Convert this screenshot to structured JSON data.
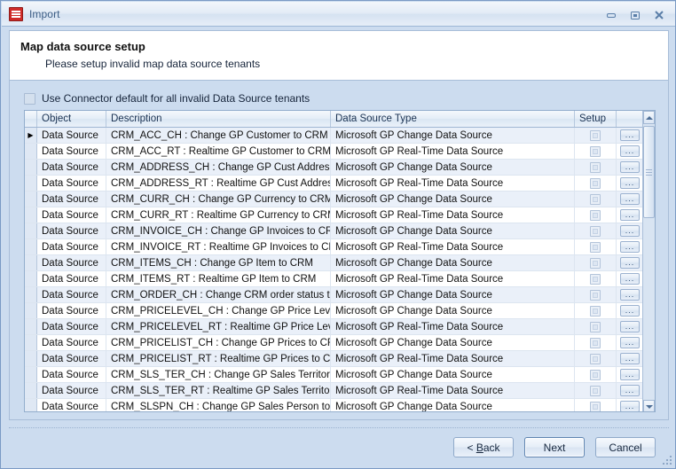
{
  "window": {
    "title": "Import",
    "icon": "document-lines-icon",
    "controls": {
      "minimize": "minimize-icon",
      "maximize": "maximize-icon",
      "close": "close-icon"
    }
  },
  "header": {
    "title": "Map data source setup",
    "subtitle": "Please setup invalid map data source tenants"
  },
  "options": {
    "use_connector_default_label": "Use Connector default for all invalid Data Source tenants",
    "use_connector_default_checked": false
  },
  "grid": {
    "columns": [
      {
        "key": "indicator",
        "label": ""
      },
      {
        "key": "object",
        "label": "Object"
      },
      {
        "key": "description",
        "label": "Description"
      },
      {
        "key": "type",
        "label": "Data Source Type"
      },
      {
        "key": "setup",
        "label": "Setup"
      },
      {
        "key": "action",
        "label": ""
      }
    ],
    "action_label": "...",
    "rows": [
      {
        "object": "Data Source",
        "description": "CRM_ACC_CH : Change GP Customer to CRM",
        "type": "Microsoft GP Change Data Source",
        "setup": false,
        "selected": true
      },
      {
        "object": "Data Source",
        "description": "CRM_ACC_RT : Realtime GP Customer to CRM",
        "type": "Microsoft GP Real-Time Data Source",
        "setup": false,
        "selected": false
      },
      {
        "object": "Data Source",
        "description": "CRM_ADDRESS_CH : Change GP Cust Address to CRM",
        "type": "Microsoft GP Change Data Source",
        "setup": false,
        "selected": false
      },
      {
        "object": "Data Source",
        "description": "CRM_ADDRESS_RT : Realtime GP Cust Address to CRM",
        "type": "Microsoft GP Real-Time Data Source",
        "setup": false,
        "selected": false
      },
      {
        "object": "Data Source",
        "description": "CRM_CURR_CH : Change GP Currency to CRM",
        "type": "Microsoft GP Change Data Source",
        "setup": false,
        "selected": false
      },
      {
        "object": "Data Source",
        "description": "CRM_CURR_RT : Realtime GP Currency to CRM",
        "type": "Microsoft GP Real-Time Data Source",
        "setup": false,
        "selected": false
      },
      {
        "object": "Data Source",
        "description": "CRM_INVOICE_CH : Change GP Invoices to CRM",
        "type": "Microsoft GP Change Data Source",
        "setup": false,
        "selected": false
      },
      {
        "object": "Data Source",
        "description": "CRM_INVOICE_RT : Realtime GP Invoices to CRM",
        "type": "Microsoft GP Real-Time Data Source",
        "setup": false,
        "selected": false
      },
      {
        "object": "Data Source",
        "description": "CRM_ITEMS_CH : Change GP Item to CRM",
        "type": "Microsoft GP Change Data Source",
        "setup": false,
        "selected": false
      },
      {
        "object": "Data Source",
        "description": "CRM_ITEMS_RT : Realtime GP Item to CRM",
        "type": "Microsoft GP Real-Time Data Source",
        "setup": false,
        "selected": false
      },
      {
        "object": "Data Source",
        "description": "CRM_ORDER_CH : Change CRM order status to Submit…",
        "type": "Microsoft GP Change Data Source",
        "setup": false,
        "selected": false
      },
      {
        "object": "Data Source",
        "description": "CRM_PRICELEVEL_CH : Change GP Price Levels to CRM",
        "type": "Microsoft GP Change Data Source",
        "setup": false,
        "selected": false
      },
      {
        "object": "Data Source",
        "description": "CRM_PRICELEVEL_RT : Realtime GP Price Levels to CRM",
        "type": "Microsoft GP Real-Time Data Source",
        "setup": false,
        "selected": false
      },
      {
        "object": "Data Source",
        "description": "CRM_PRICELIST_CH : Change GP Prices to CRM",
        "type": "Microsoft GP Change Data Source",
        "setup": false,
        "selected": false
      },
      {
        "object": "Data Source",
        "description": "CRM_PRICELIST_RT : Realtime GP Prices to CRM",
        "type": "Microsoft GP Real-Time Data Source",
        "setup": false,
        "selected": false
      },
      {
        "object": "Data Source",
        "description": "CRM_SLS_TER_CH : Change GP Sales Territory to CRM",
        "type": "Microsoft GP Change Data Source",
        "setup": false,
        "selected": false
      },
      {
        "object": "Data Source",
        "description": "CRM_SLS_TER_RT : Realtime GP Sales Territory to CRM",
        "type": "Microsoft GP Real-Time Data Source",
        "setup": false,
        "selected": false
      },
      {
        "object": "Data Source",
        "description": "CRM_SLSPN_CH : Change GP Sales Person to CRM",
        "type": "Microsoft GP Change Data Source",
        "setup": false,
        "selected": false
      }
    ]
  },
  "footer": {
    "back_label": "< Back",
    "next_label": "Next",
    "cancel_label": "Cancel"
  },
  "colors": {
    "window_bg": "#ccdcef",
    "panel_border": "#a8bdd8",
    "header_bg": "#ffffff",
    "row_alt": "#eaf0f9",
    "accent": "#3b5c84",
    "app_icon": "#cf2b28"
  }
}
